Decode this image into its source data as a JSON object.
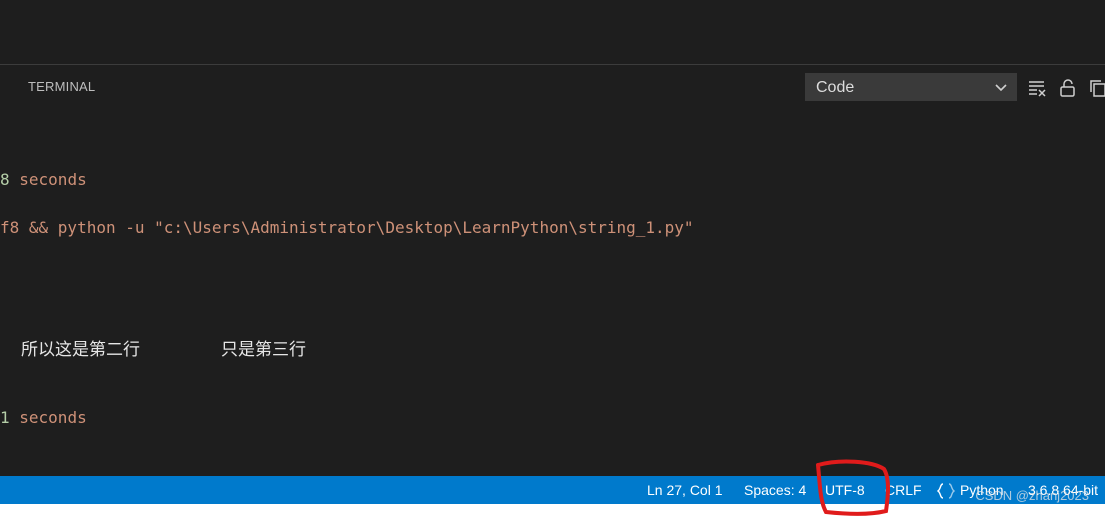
{
  "panel": {
    "tab_terminal": "TERMINAL",
    "output_select": {
      "value": "Code"
    }
  },
  "terminal": {
    "line1_num": "8",
    "line1_text": " seconds",
    "line2_prefix": "f8",
    "line2_text": " && python -u \"c:\\Users\\Administrator\\Desktop\\LearnPython\\string_1.py\"",
    "cjk_a": "所以这是第二行",
    "cjk_b": "只是第三行",
    "line4_num": "1",
    "line4_text": " seconds"
  },
  "statusbar": {
    "position": "Ln 27, Col 1",
    "spaces": "Spaces: 4",
    "encoding": "UTF-8",
    "eol": "CRLF",
    "language": "Python",
    "interpreter": "3.6.8 64-bit"
  },
  "watermark": "CSDN @zhanj2023",
  "icons": [
    "clear-output-icon",
    "lock-icon",
    "copy-icon",
    "chevron-down-icon",
    "braces-icon"
  ],
  "colors": {
    "background": "#1e1e1e",
    "statusbar": "#007acc",
    "terminal_orange": "#ce9178",
    "terminal_green": "#b5cea8",
    "annotation_red": "#e01b1b"
  }
}
